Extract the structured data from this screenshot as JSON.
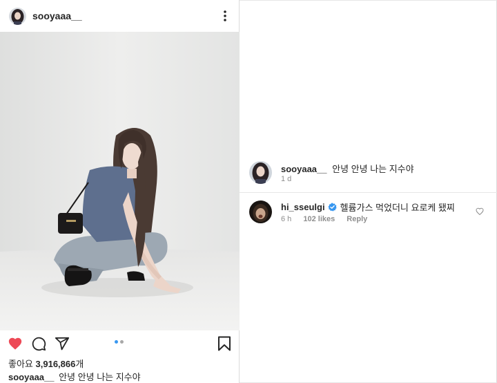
{
  "post": {
    "username": "sooyaaa__",
    "likes_label": "좋아요",
    "likes_count": "3,916,866",
    "likes_unit": "개",
    "caption_user": "sooyaaa__",
    "caption_text": "안녕 안녕 나는 지수야",
    "carousel": {
      "total": 2,
      "active_index": 0
    },
    "icons": [
      "more-icon",
      "heart-icon",
      "comment-icon",
      "share-icon",
      "bookmark-icon"
    ],
    "colors": {
      "liked_heart": "#ed4956",
      "verified": "#3897f0",
      "active_dot": "#3897f0",
      "muted_text": "#8e8e8e"
    }
  },
  "comments_panel": {
    "author_post": {
      "username": "sooyaaa__",
      "text": "안녕 안녕 나는 지수야",
      "time": "1 d"
    },
    "comments": [
      {
        "username": "hi_sseulgi",
        "verified": true,
        "text": "헬륨가스 먹었더니 요로케 됐찌",
        "time": "6 h",
        "likes": "102 likes",
        "reply_label": "Reply"
      }
    ]
  }
}
